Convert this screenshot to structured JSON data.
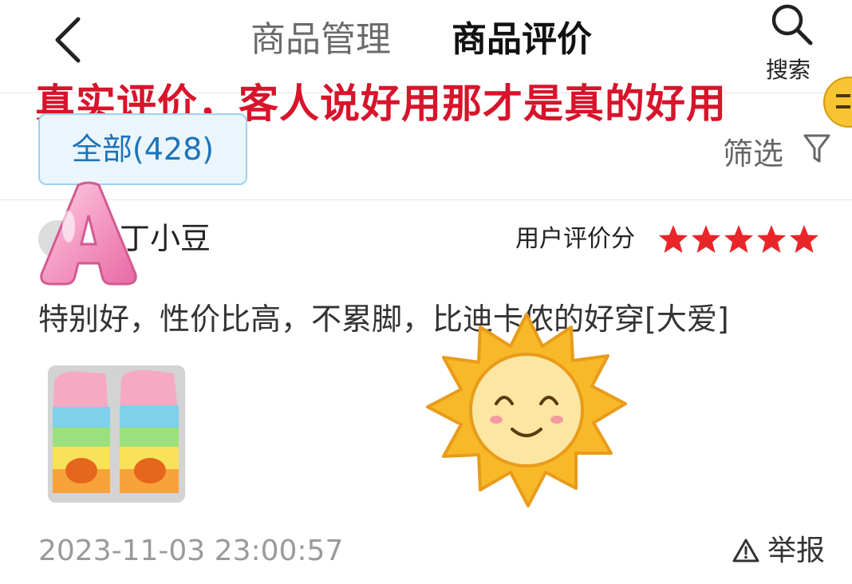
{
  "header": {
    "tabs": [
      {
        "label": "商品管理",
        "active": false
      },
      {
        "label": "商品评价",
        "active": true
      }
    ],
    "search_label": "搜索",
    "back_icon": "chevron-left-icon",
    "search_icon": "magnifier-icon"
  },
  "banner": {
    "text": "真实评价，客人说好用那才是真的好用",
    "color": "#d7142b"
  },
  "filters": {
    "all_label": "全部(428)",
    "filter_label": "筛选",
    "filter_icon": "funnel-icon"
  },
  "review": {
    "username": "丁小豆",
    "rating_label": "用户评价分",
    "rating": 5,
    "rating_max": 5,
    "star_color": "#e8262a",
    "text": "特别好，性价比高，不累脚，比迪卡侬的好穿[大爱]",
    "photo_icon": "rainbow-swim-fins-photo",
    "timestamp": "2023-11-03 23:00:57",
    "report_label": "举报",
    "report_icon": "warning-triangle-icon"
  },
  "stickers": {
    "letter": "A",
    "sun": "smiling-sun-sticker"
  }
}
